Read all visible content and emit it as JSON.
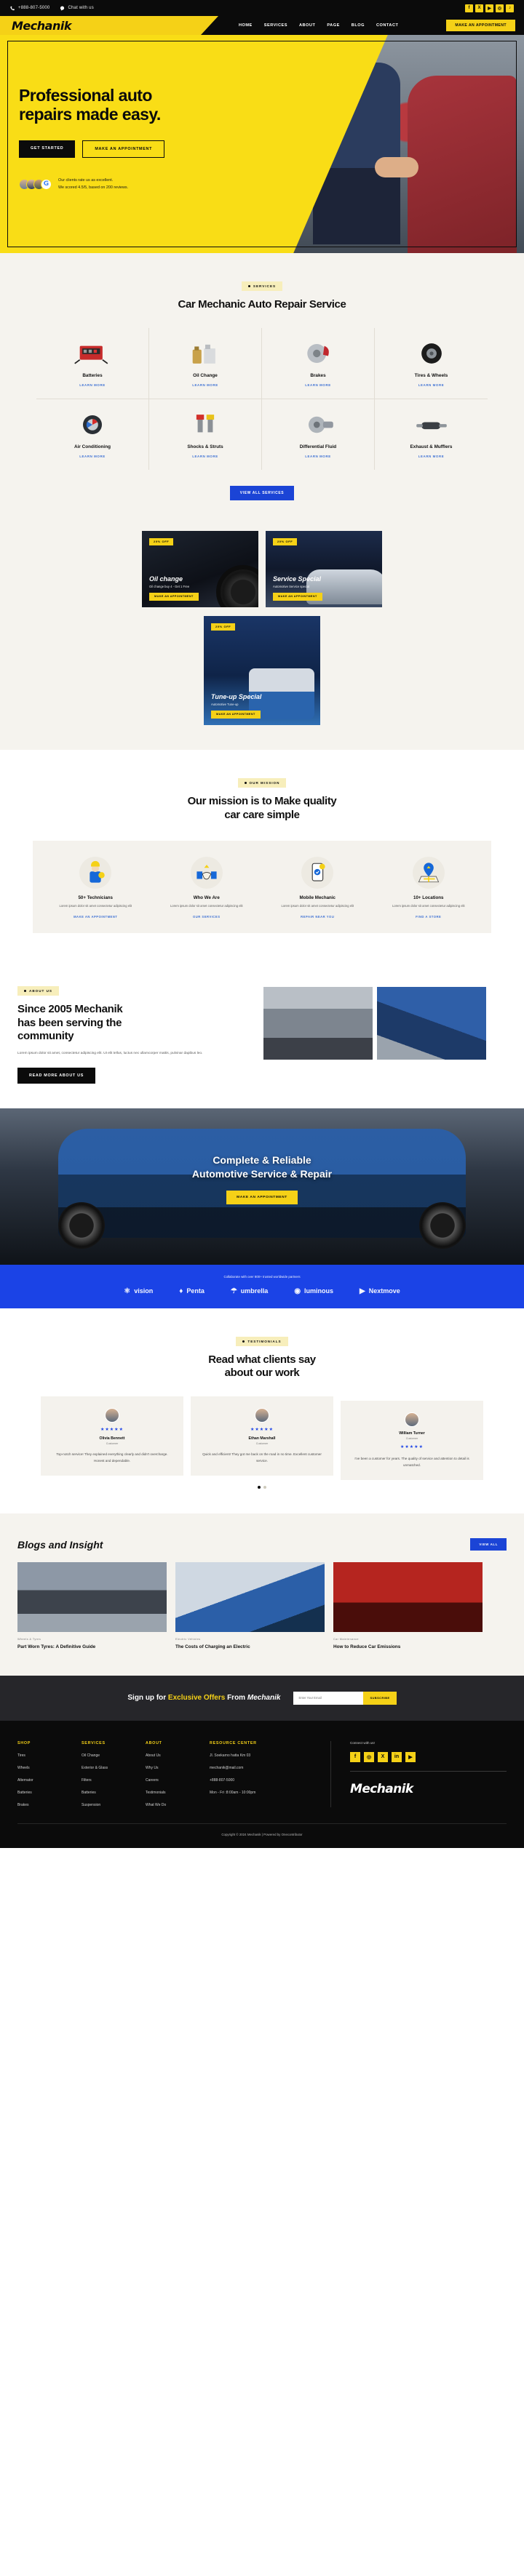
{
  "topbar": {
    "phone": "+888-807-5000",
    "chat": "Chat with us",
    "socials": [
      "f",
      "X",
      "▶",
      "◎",
      "♪"
    ]
  },
  "header": {
    "logo": "Mechanik",
    "nav": [
      "HOME",
      "SERVICES",
      "ABOUT",
      "PAGE",
      "BLOG",
      "CONTACT"
    ],
    "cta": "MAKE AN APPOINTMENT"
  },
  "hero": {
    "title_line1": "Professional auto",
    "title_line2": "repairs made easy.",
    "btn_primary": "GET STARTED",
    "btn_secondary": "MAKE AN APPOINTMENT",
    "rating_line1": "Our clients rate us as excellent.",
    "rating_line2": "We scored 4.5/5, based on  200 reviews.",
    "google_mark": "G"
  },
  "services": {
    "pill": "SERVICES",
    "title": "Car Mechanic Auto Repair Service",
    "learn_more": "LEARN MORE",
    "items": [
      {
        "name": "Batteries",
        "icon": "battery-charger-icon"
      },
      {
        "name": "Oil Change",
        "icon": "oil-bottle-icon"
      },
      {
        "name": "Brakes",
        "icon": "brake-disc-icon"
      },
      {
        "name": "Tires & Wheels",
        "icon": "tire-icon"
      },
      {
        "name": "Air Conditioning",
        "icon": "ac-compressor-icon"
      },
      {
        "name": "Shocks & Struts",
        "icon": "shock-absorber-icon"
      },
      {
        "name": "Differential Fluid",
        "icon": "differential-icon"
      },
      {
        "name": "Exhaust & Mufflers",
        "icon": "muffler-icon"
      }
    ],
    "view_all": "VIEW ALL SERVICES"
  },
  "promos": [
    {
      "tag": "20% OFF",
      "title": "Oil change",
      "sub": "Oil change buy 4 - Get 1 Free",
      "btn": "MAKE AN APPOINTMENT"
    },
    {
      "tag": "20% OFF",
      "title": "Service Special",
      "sub": "Automotive Service special",
      "btn": "MAKE AN APPOINTMENT"
    },
    {
      "tag": "20% OFF",
      "title": "Tune-up Special",
      "sub": "Automotive Tune-up",
      "btn": "MAKE AN APPOINTMENT"
    }
  ],
  "mission": {
    "pill": "OUR MISSION",
    "title_line1": "Our mission is to Make quality",
    "title_line2": "car care simple",
    "cells": [
      {
        "title": "50+ Technicians",
        "desc": "Lorem ipsum dolor sit amet consectetur adipiscing elit",
        "link": "MAKE AN APPOINTMENT",
        "icon": "technician-icon"
      },
      {
        "title": "Who We Are",
        "desc": "Lorem ipsum dolor sit amet consectetur adipiscing elit",
        "link": "OUR SERVICES",
        "icon": "handshake-icon"
      },
      {
        "title": "Mobile Mechanic",
        "desc": "Lorem ipsum dolor sit amet consectetur adipiscing elit",
        "link": "REPAIR NEAR YOU",
        "icon": "mobile-phone-icon"
      },
      {
        "title": "10+ Locations",
        "desc": "Lorem ipsum dolor sit amet consectetur adipiscing elit",
        "link": "FIND A STORE",
        "icon": "map-pin-icon"
      }
    ]
  },
  "about": {
    "pill": "ABOUT US",
    "title_line1": "Since 2005 Mechanik",
    "title_line2": "has been serving the",
    "title_line3": "community",
    "body": "Lorem ipsum dolor sit amet, consectetur adipiscing elit. Ut elit tellus, luctus nec ullamcorper mattis, pulvinar dapibus leo.",
    "btn": "READ MORE ABOUT US"
  },
  "cta": {
    "title_line1": "Complete & Reliable",
    "title_line2": "Automotive Service & Repair",
    "btn": "MAKE AN APPOINTMENT"
  },
  "partners": {
    "lead": "Collaborate with over 800+ trusted worldwide partners",
    "logos": [
      "vision",
      "Penta",
      "umbrella",
      "luminous",
      "Nextmove"
    ]
  },
  "testimonials": {
    "pill": "TESTIMONIALS",
    "title_line1": "Read what clients say",
    "title_line2": "about our work",
    "items": [
      {
        "name": "Olivia Bennett",
        "role": "Customer",
        "stars": "★★★★★",
        "quote": "Top-notch service! They explained everything clearly and didn't overcharge. Honest and dependable."
      },
      {
        "name": "Ethan Marshall",
        "role": "Customer",
        "stars": "★★★★★",
        "quote": "Quick and efficient! They got me back on the road in no time. Excellent customer service."
      },
      {
        "name": "William Turner",
        "role": "Customer",
        "stars": "★★★★★",
        "quote": "I've been a customer for years. The quality of service and attention to detail is unmatched."
      }
    ]
  },
  "blog": {
    "title": "Blogs and Insight",
    "view_all": "VIEW ALL",
    "posts": [
      {
        "tag": "Wheels & Tyres",
        "title": "Part Worn Tyres: A Definitive Guide"
      },
      {
        "tag": "Electric Vehicles",
        "title": "The Costs of Charging an Electric"
      },
      {
        "tag": "Car Maintenance",
        "title": "How to Reduce Car Emissions"
      }
    ]
  },
  "newsletter": {
    "pre": "Sign up for ",
    "highlight": "Exclusive Offers",
    "mid": " From ",
    "brand": "Mechanik",
    "placeholder": "Enter Your Email",
    "btn": "SUBSCRIBE"
  },
  "footer": {
    "columns": [
      {
        "head": "SHOP",
        "items": [
          "Tires",
          "Wheels",
          "Alternator",
          "Batteries",
          "Brakes"
        ]
      },
      {
        "head": "SERVICES",
        "items": [
          "Oil Change",
          "Exterior & Glass",
          "Filters",
          "Batteries",
          "Suspension"
        ]
      },
      {
        "head": "ABOUT",
        "items": [
          "About Us",
          "Why Us",
          "Careers",
          "Testimonials",
          "What We Do"
        ]
      },
      {
        "head": "RESOURCE CENTER",
        "items": [
          "Jl. Soekarno hatta Km 03",
          "mechanik@mail.com",
          "+888-807-5000",
          "Mon - Fri :8:00am - 10:00pm"
        ]
      }
    ],
    "connect": "Connect with us!",
    "socials": [
      "f",
      "◎",
      "X",
      "in",
      "▶"
    ],
    "logo": "Mechanik",
    "copyright": "Copyright © 2024 Mechanik | Powered by Onecontributor"
  },
  "colors": {
    "yellow": "#f9dd16",
    "brand_yellow": "#f5d117",
    "blue": "#1b44d6",
    "dark": "#0b0b0b",
    "cream": "#f5f3ee"
  }
}
